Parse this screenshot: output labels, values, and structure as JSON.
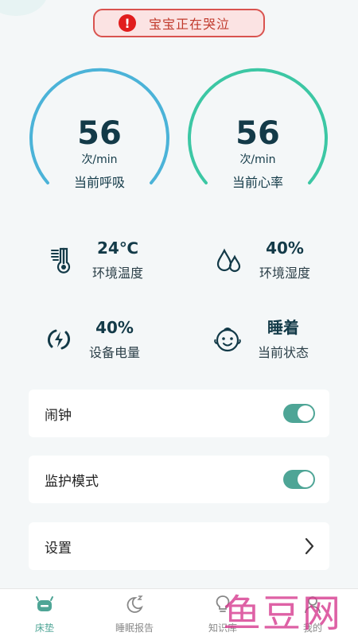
{
  "alert": {
    "text": "宝宝正在哭泣",
    "icon": "exclamation-icon"
  },
  "gauges": [
    {
      "value": "56",
      "unit": "次/min",
      "label": "当前呼吸",
      "color": "#4bb3d8"
    },
    {
      "value": "56",
      "unit": "次/min",
      "label": "当前心率",
      "color": "#3cc7a4"
    }
  ],
  "stats": {
    "temperature": {
      "value": "24℃",
      "label": "环境温度",
      "icon": "thermometer-icon"
    },
    "humidity": {
      "value": "40%",
      "label": "环境湿度",
      "icon": "water-drops-icon"
    },
    "battery": {
      "value": "40%",
      "label": "设备电量",
      "icon": "battery-charge-icon"
    },
    "state": {
      "value": "睡着",
      "label": "当前状态",
      "icon": "baby-face-icon"
    }
  },
  "cards": {
    "alarm": {
      "label": "闹钟",
      "on": true
    },
    "monitor": {
      "label": "监护模式",
      "on": true
    },
    "settings": {
      "label": "设置"
    }
  },
  "tabs": [
    {
      "label": "床垫",
      "icon": "android-icon",
      "active": true
    },
    {
      "label": "睡眠报告",
      "icon": "moon-icon",
      "active": false
    },
    {
      "label": "知识库",
      "icon": "bulb-icon",
      "active": false
    },
    {
      "label": "我的",
      "icon": "person-icon",
      "active": false
    }
  ],
  "watermark": "鱼豆网",
  "colors": {
    "accent": "#4ea596",
    "alert": "#e11d1d",
    "text": "#133a48"
  }
}
